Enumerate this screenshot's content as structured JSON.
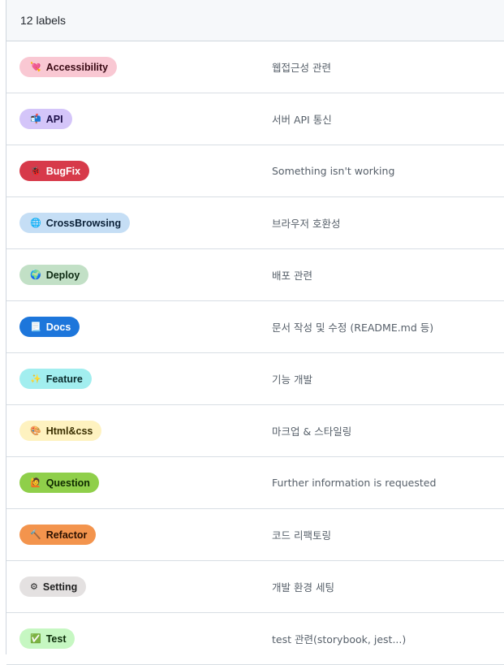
{
  "header": {
    "count_text": "12 labels"
  },
  "labels": [
    {
      "name": "Accessibility",
      "emoji": "💘",
      "icon": "heart-icon",
      "description": "웹접근성 관련",
      "bg": "#f9c8d3",
      "fg": "#3a0a14"
    },
    {
      "name": "API",
      "emoji": "📬",
      "icon": "mailbox-icon",
      "description": "서버 API 통신",
      "bg": "#d4c5f9",
      "fg": "#1d0f4a"
    },
    {
      "name": "BugFix",
      "emoji": "🐞",
      "icon": "ladybug-icon",
      "description": "Something isn't working",
      "bg": "#d73a4a",
      "fg": "#ffffff"
    },
    {
      "name": "CrossBrowsing",
      "emoji": "🌐",
      "icon": "computer-icon",
      "description": "브라우저 호환성",
      "bg": "#c5def5",
      "fg": "#0b2138"
    },
    {
      "name": "Deploy",
      "emoji": "🌍",
      "icon": "globe-icon",
      "description": "배포 관련",
      "bg": "#c2e0c6",
      "fg": "#0d2a12"
    },
    {
      "name": "Docs",
      "emoji": "📃",
      "icon": "document-icon",
      "description": "문서 작성 및 수정 (README.md 등)",
      "bg": "#1d76db",
      "fg": "#ffffff"
    },
    {
      "name": "Feature",
      "emoji": "✨",
      "icon": "sparkles-icon",
      "description": "기능 개발",
      "bg": "#a2eeef",
      "fg": "#0a2b2c"
    },
    {
      "name": "Html&css",
      "emoji": "🎨",
      "icon": "palette-icon",
      "description": "마크업 & 스타일링",
      "bg": "#fef2c0",
      "fg": "#3a2f00"
    },
    {
      "name": "Question",
      "emoji": "🙋",
      "icon": "raising-hand-icon",
      "description": "Further information is requested",
      "bg": "#8fcf4a",
      "fg": "#0f2a00"
    },
    {
      "name": "Refactor",
      "emoji": "🔨",
      "icon": "hammer-icon",
      "description": "코드 리팩토링",
      "bg": "#f3944d",
      "fg": "#2a1000"
    },
    {
      "name": "Setting",
      "emoji": "⚙",
      "icon": "gear-icon",
      "description": "개발 환경 세팅",
      "bg": "#e4e1e1",
      "fg": "#1f1f1f"
    },
    {
      "name": "Test",
      "emoji": "✅",
      "icon": "checkmark-icon",
      "description": "test 관련(storybook, jest...)",
      "bg": "#c6f7c2",
      "fg": "#0a2b08"
    }
  ]
}
